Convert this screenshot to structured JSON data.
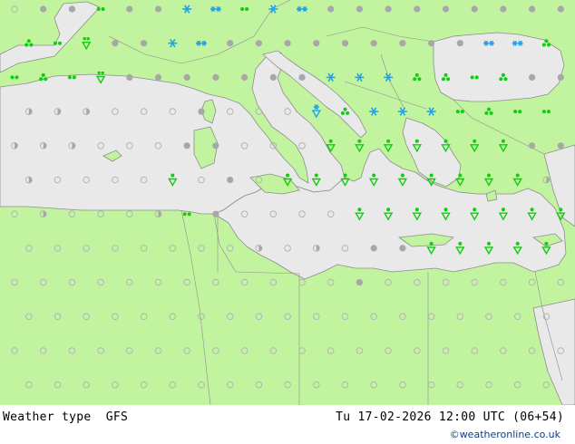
{
  "caption": {
    "title": "Weather type",
    "model": "GFS",
    "valid_time": "Tu 17-02-2026 12:00 UTC (06+54)"
  },
  "credit": "©weatheronline.co.uk",
  "colors": {
    "land": "#c2f4a0",
    "sea": "#e9e9e9",
    "border": "#8c8c8c",
    "rain_symbol": "#11cc11",
    "snow_symbol": "#1fa2f0",
    "cloud_symbol": "#a7a7a7",
    "clear_symbol": "#b4b4b4"
  },
  "legend_icons": {
    "clear": "open-circle-icon",
    "cloudy": "grey-dot-icon",
    "partly_cloudy": "half-circle-icon",
    "rain": "rain-drops-icon",
    "showers": "shower-triangle-icon",
    "snow": "snowflake-icon",
    "snow_showers": "snow-shower-triangle-icon"
  },
  "grid": {
    "rows": [
      [
        "o",
        "c",
        "c",
        "r2",
        "c",
        "c",
        "s",
        "s2",
        "r2",
        "s",
        "s2",
        "c",
        "c",
        "c",
        "c",
        "c",
        "c",
        "c",
        "c",
        "c",
        "c"
      ],
      [
        "r3",
        "r2",
        "vr",
        "c",
        "c",
        "s",
        "s2",
        "c",
        "c",
        "c",
        "c",
        "c",
        "c",
        "c",
        "c",
        "c",
        "s2",
        "s2",
        "r3"
      ],
      [
        "r2",
        "r3",
        "r2",
        "vr",
        "c",
        "c",
        "c",
        "c",
        "c",
        "c",
        "c",
        "s",
        "s",
        "s",
        "r3",
        "r3",
        "r2",
        "r3",
        "c",
        "c"
      ],
      [
        "h",
        "h",
        "h",
        "o",
        "o",
        "o",
        "c",
        "o",
        "o",
        "o",
        "vs",
        "r3",
        "s",
        "s",
        "s",
        "r2",
        "r3",
        "r2",
        "r2",
        "c"
      ],
      [
        "h",
        "h",
        "h",
        "o",
        "o",
        "o",
        "c",
        "c",
        "o",
        "o",
        "o",
        "t",
        "t",
        "t",
        "t",
        "t",
        "t",
        "t",
        "c",
        "c",
        "c"
      ],
      [
        "h",
        "o",
        "o",
        "o",
        "o",
        "t",
        "o",
        "c",
        "o",
        "t",
        "t",
        "t",
        "t",
        "t",
        "t",
        "t",
        "t",
        "t",
        "h",
        "h"
      ],
      [
        "o",
        "h",
        "o",
        "o",
        "o",
        "h",
        "r2",
        "c",
        "o",
        "o",
        "o",
        "o",
        "t",
        "t",
        "t",
        "t",
        "t",
        "t",
        "t",
        "t"
      ],
      [
        "o",
        "o",
        "o",
        "o",
        "o",
        "o",
        "o",
        "o",
        "h",
        "o",
        "h",
        "o",
        "c",
        "c",
        "t",
        "t",
        "t",
        "t",
        "t",
        "t"
      ],
      [
        "o",
        "o",
        "o",
        "o",
        "o",
        "o",
        "o",
        "o",
        "o",
        "o",
        "o",
        "o",
        "c",
        "o",
        "o",
        "o",
        "o",
        "o",
        "o",
        "o"
      ],
      [
        "o",
        "o",
        "o",
        "o",
        "o",
        "o",
        "o",
        "o",
        "o",
        "o",
        "o",
        "o",
        "o",
        "o",
        "o",
        "o",
        "o",
        "o",
        "o",
        "o"
      ],
      [
        "o",
        "o",
        "o",
        "o",
        "o",
        "o",
        "o",
        "o",
        "o",
        "o",
        "o",
        "o",
        "o",
        "o",
        "o",
        "o",
        "o",
        "o",
        "o",
        "o"
      ],
      [
        "o",
        "o",
        "o",
        "o",
        "o",
        "o",
        "o",
        "o",
        "o",
        "o",
        "o",
        "o",
        "o",
        "o",
        "o",
        "o",
        "o",
        "o",
        "o",
        "o"
      ]
    ]
  }
}
